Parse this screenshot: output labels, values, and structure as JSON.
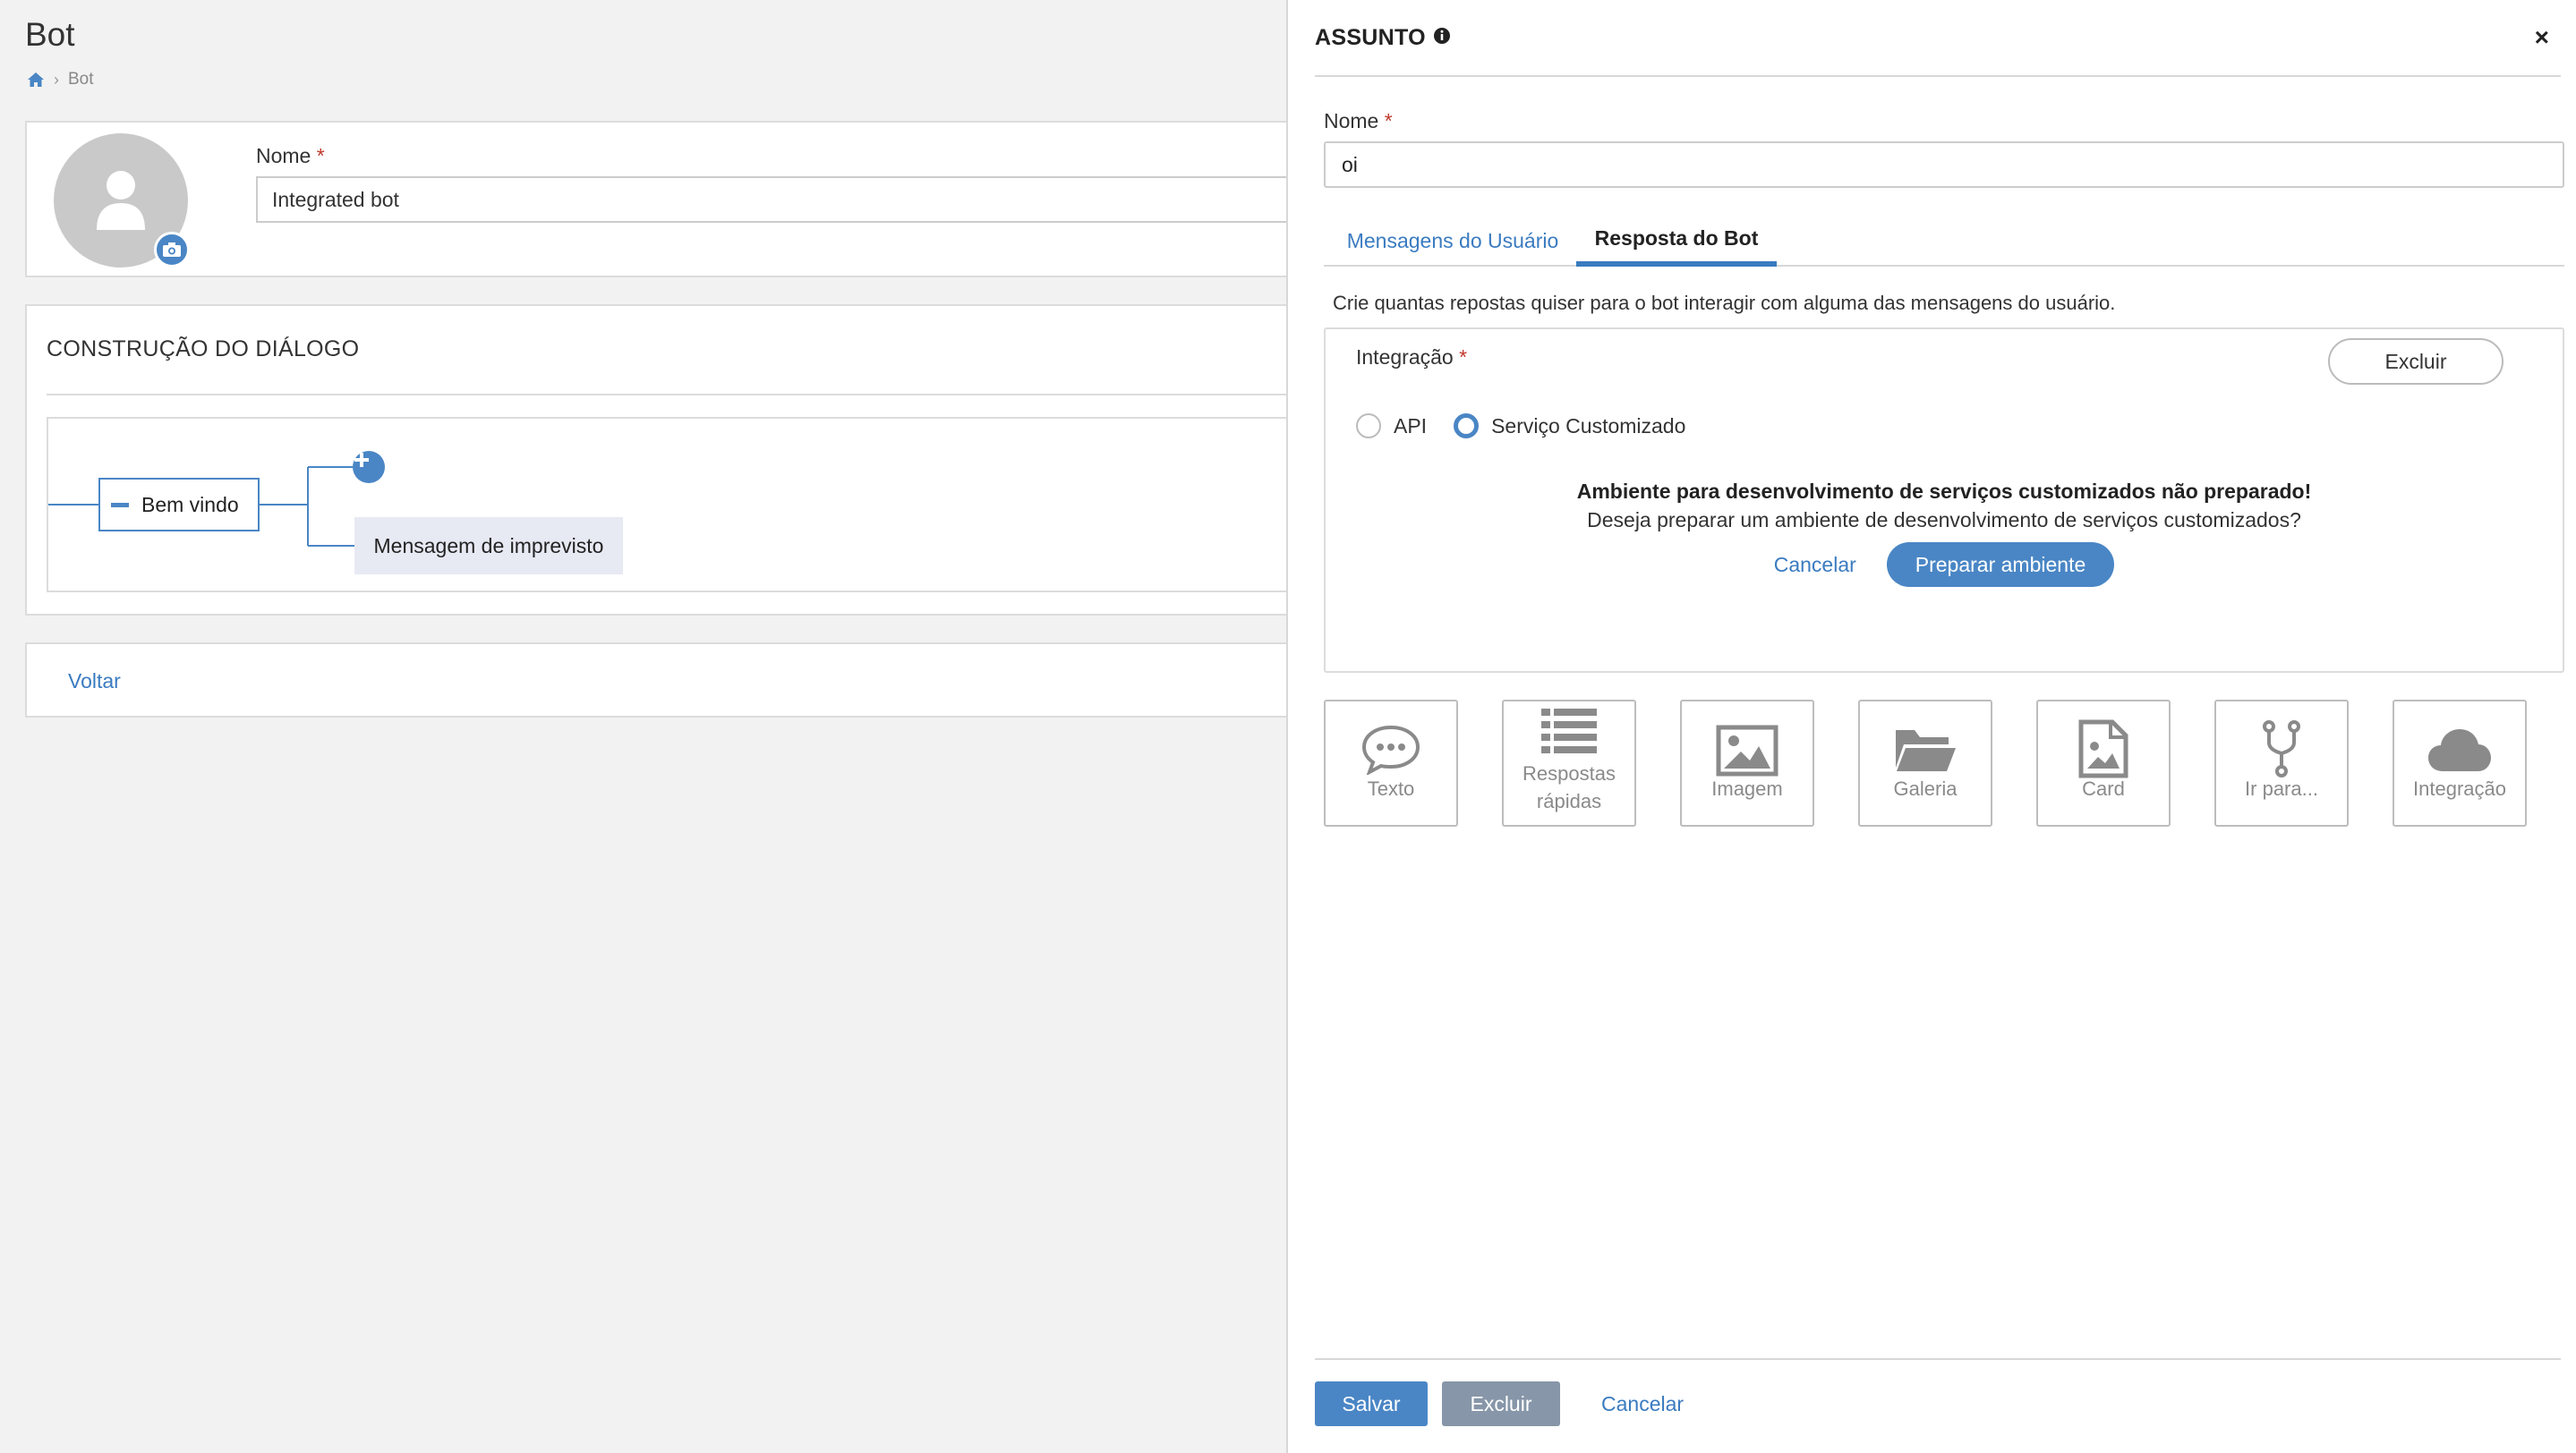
{
  "page": {
    "title": "Bot",
    "breadcrumb": {
      "current": "Bot"
    }
  },
  "profile": {
    "name_label": "Nome",
    "required_mark": "*",
    "name_value": "Integrated bot"
  },
  "dialog": {
    "title": "CONSTRUÇÃO DO DIÁLOGO",
    "nodes": {
      "main": "Bem vindo",
      "fallback": "Mensagem de imprevisto"
    }
  },
  "back_label": "Voltar",
  "panel": {
    "title": "ASSUNTO",
    "name_label": "Nome",
    "required_mark": "*",
    "name_value": "oi",
    "tabs": [
      {
        "label": "Mensagens do Usuário",
        "active": false
      },
      {
        "label": "Resposta do Bot",
        "active": true
      }
    ],
    "help_text": "Crie quantas repostas quiser para o bot interagir com alguma das mensagens do usuário.",
    "integration": {
      "label": "Integração",
      "required_mark": "*",
      "delete_label": "Excluir",
      "options": [
        {
          "label": "API",
          "selected": false
        },
        {
          "label": "Serviço Customizado",
          "selected": true
        }
      ],
      "warning_title": "Ambiente para desenvolvimento de serviços customizados não preparado!",
      "warning_text": "Deseja preparar um ambiente de desenvolvimento de serviços customizados?",
      "cancel_label": "Cancelar",
      "prepare_label": "Preparar ambiente"
    },
    "tiles": [
      {
        "label": "Texto",
        "icon": "speech-bubble-icon"
      },
      {
        "label": "Respostas rápidas",
        "icon": "list-icon"
      },
      {
        "label": "Imagem",
        "icon": "image-icon"
      },
      {
        "label": "Galeria",
        "icon": "folder-open-icon"
      },
      {
        "label": "Card",
        "icon": "file-image-icon"
      },
      {
        "label": "Ir para...",
        "icon": "code-fork-icon"
      },
      {
        "label": "Integração",
        "icon": "cloud-icon"
      }
    ],
    "footer": {
      "save_label": "Salvar",
      "delete_label": "Excluir",
      "cancel_label": "Cancelar"
    }
  },
  "colors": {
    "accent": "#4a86c5",
    "link": "#3a7bc0",
    "required": "#c0392b",
    "muted_button": "#8796a8",
    "background": "#f2f2f2"
  }
}
